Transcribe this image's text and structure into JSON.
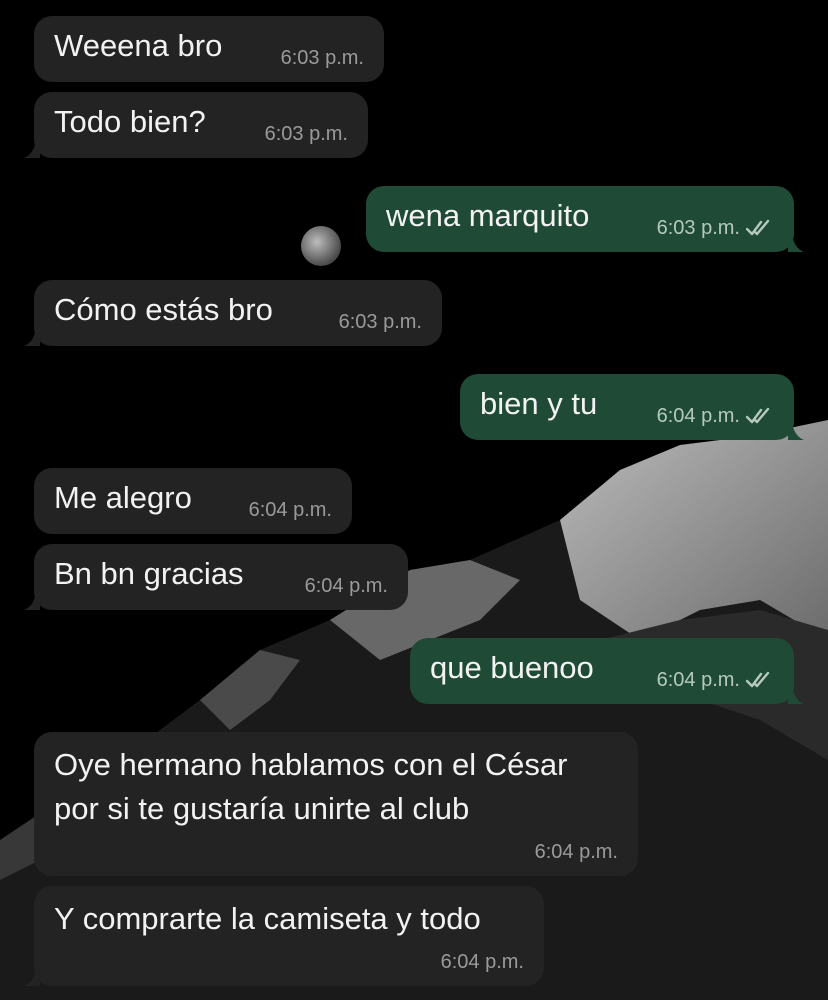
{
  "colors": {
    "incoming_bubble": "#232323",
    "outgoing_bubble": "#1f4a36",
    "timestamp": "#9a9a9a",
    "background": "#000000"
  },
  "messages": [
    {
      "direction": "in",
      "text": "Weeena bro",
      "time": "6:03 p.m."
    },
    {
      "direction": "in",
      "text": "Todo bien?",
      "time": "6:03 p.m."
    },
    {
      "direction": "out",
      "text": "wena marquito",
      "time": "6:03 p.m.",
      "status_icon": "double-check-icon"
    },
    {
      "direction": "in",
      "text": "Cómo estás bro",
      "time": "6:03 p.m."
    },
    {
      "direction": "out",
      "text": "bien y tu",
      "time": "6:04 p.m.",
      "status_icon": "double-check-icon"
    },
    {
      "direction": "in",
      "text": "Me alegro",
      "time": "6:04 p.m."
    },
    {
      "direction": "in",
      "text": "Bn bn gracias",
      "time": "6:04 p.m."
    },
    {
      "direction": "out",
      "text": "que buenoo",
      "time": "6:04 p.m.",
      "status_icon": "double-check-icon"
    },
    {
      "direction": "in",
      "text_lines": [
        "Oye hermano hablamos con el César",
        "por si te gustaría unirte al club"
      ],
      "time": "6:04 p.m."
    },
    {
      "direction": "in",
      "text": "Y comprarte la camiseta y todo",
      "time": "6:04 p.m."
    }
  ]
}
